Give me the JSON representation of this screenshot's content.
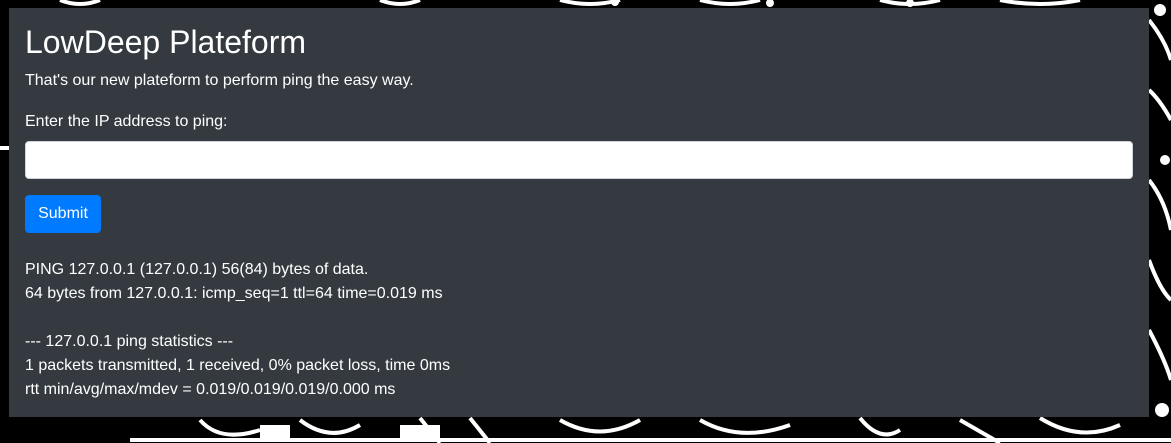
{
  "page": {
    "title": "LowDeep Plateform",
    "subtitle": "That's our new plateform to perform ping the easy way."
  },
  "form": {
    "label": "Enter the IP address to ping:",
    "input_value": "",
    "input_placeholder": "",
    "submit_label": "Submit"
  },
  "output": {
    "lines": [
      "PING 127.0.0.1 (127.0.0.1) 56(84) bytes of data.",
      "64 bytes from 127.0.0.1: icmp_seq=1 ttl=64 time=0.019 ms",
      "",
      "--- 127.0.0.1 ping statistics ---",
      "1 packets transmitted, 1 received, 0% packet loss, time 0ms",
      "rtt min/avg/max/mdev = 0.019/0.019/0.019/0.000 ms"
    ]
  },
  "colors": {
    "panel_background": "#343a40",
    "button_background": "#007bff",
    "page_background": "#000000"
  }
}
